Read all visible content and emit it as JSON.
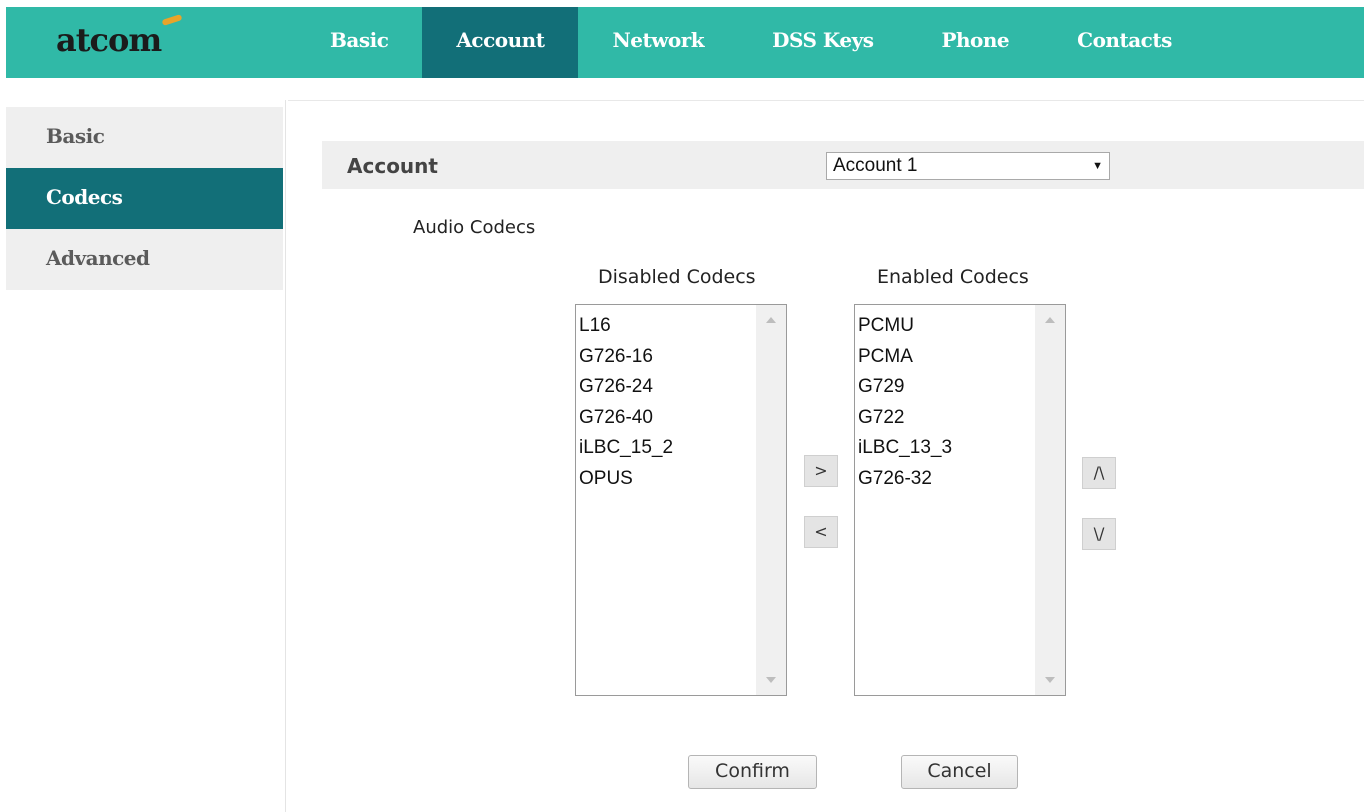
{
  "brand": {
    "logo_text": "atcom",
    "accent_color": "#30b9a7",
    "active_color": "#126f78"
  },
  "top_nav": {
    "items": [
      {
        "label": "Basic",
        "active": false
      },
      {
        "label": "Account",
        "active": true
      },
      {
        "label": "Network",
        "active": false
      },
      {
        "label": "DSS Keys",
        "active": false
      },
      {
        "label": "Phone",
        "active": false
      },
      {
        "label": "Contacts",
        "active": false
      }
    ]
  },
  "sidebar": {
    "items": [
      {
        "label": "Basic",
        "active": false
      },
      {
        "label": "Codecs",
        "active": true
      },
      {
        "label": "Advanced",
        "active": false
      }
    ]
  },
  "account": {
    "label": "Account",
    "selected": "Account 1"
  },
  "audio_codecs": {
    "section_label": "Audio Codecs",
    "disabled_label": "Disabled Codecs",
    "enabled_label": "Enabled Codecs",
    "disabled": [
      "L16",
      "G726-16",
      "G726-24",
      "G726-40",
      "iLBC_15_2",
      "OPUS"
    ],
    "enabled": [
      "PCMU",
      "PCMA",
      "G729",
      "G722",
      "iLBC_13_3",
      "G726-32"
    ],
    "move_right": ">",
    "move_left": "<",
    "move_up": "/\\",
    "move_down": "\\/"
  },
  "actions": {
    "confirm": "Confirm",
    "cancel": "Cancel"
  }
}
